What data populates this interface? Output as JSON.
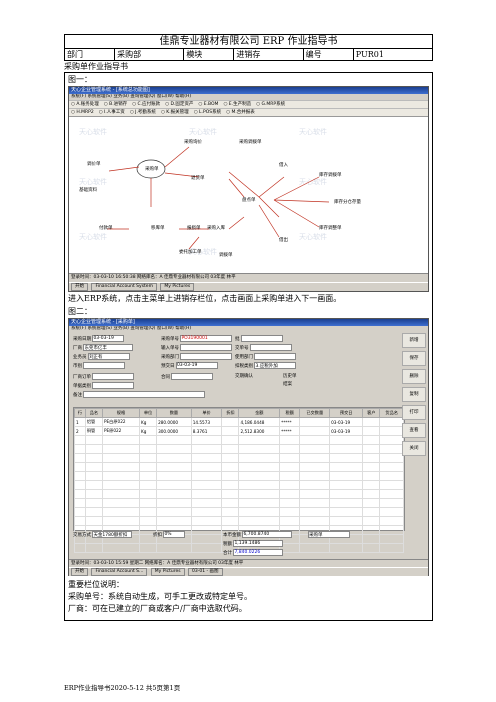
{
  "doc": {
    "title": "佳鼎专业器材有限公司 ERP 作业指导书",
    "subtitle": "采购单作业指导书",
    "figure1_label": "图一：",
    "figure2_label": "图二：",
    "caption1": "进入ERP系统，点击主菜单上进销存栏位，点击画面上采购单进入下一画面。"
  },
  "meta": {
    "dept_label": "部门",
    "dept_value": "采购部",
    "module_label": "模块",
    "module_value": "进销存",
    "number_label": "编号",
    "number_value": "PUR01"
  },
  "shot1": {
    "title": "天心企业管理系统 - [系统总功能图]",
    "menu": "系统(F) 系统管理(S) 业务(B) 查询管理(Q) 窗口(W) 帮助(H)",
    "modules": [
      "A.账务处理",
      "B.进销存",
      "C.应付账款",
      "D.固定资产",
      "E.BOM",
      "E.生产制造",
      "G.MRP系统"
    ],
    "modules2": [
      "H.MRP2",
      "I.人事工资",
      "J.考勤系统",
      "K.报关管理",
      "L.POS系统",
      "M.合并报表"
    ],
    "nodes": [
      "采购单",
      "采购询价",
      "采购调拨单",
      "调价单",
      "退货单",
      "基础资料",
      "借入",
      "库存调拨单",
      "付款单",
      "移库单",
      "盘点单",
      "库存分仓存量",
      "报损单",
      "借出",
      "库存调整单",
      "委托加工单",
      "调拨单",
      "采购入库"
    ],
    "watermark": "天心软件",
    "status": "登录时间：03-03-10 16:50:38 网络库名：A 佳鼎专业器材有限公司 03年度 林平",
    "task": [
      "开始",
      "Financial Account System",
      "My Pictures"
    ]
  },
  "shot2": {
    "title": "天心企业管理系统 - [采购单]",
    "fields": {
      "date_label": "采购日期",
      "date_value": "03-03-19",
      "order_label": "采购单号",
      "order_value": "PO3190001",
      "vendor_label": "厂商",
      "vendor_value": "东莞市亿丰",
      "enter_label": "输入单号",
      "buyer_label": "业务员",
      "buyer_value": "刘正有",
      "dept_label": "采购部门",
      "place_label": "币别",
      "deliver_label": "预交日",
      "deliver_value": "03-03-19",
      "tax_label": "扣税类别",
      "tax_value": "3.应税外加",
      "bag_label": "批",
      "ship_label": "交单号",
      "use_label": "使用部门",
      "vendor_order_label": "厂商订单",
      "contract_label": "合同",
      "dept_code_label": "单据类别",
      "remark_label": "备注",
      "chk1": "交期确认",
      "chk2": "历史单",
      "chk3": "结案"
    },
    "columns": [
      "行",
      "品名",
      "规格",
      "单位",
      "数量",
      "单价",
      "折扣",
      "金额",
      "税额",
      "已交数量",
      "预交日",
      "客户",
      "货品名"
    ],
    "rows": [
      [
        "1",
        "铝管",
        "PE白原022",
        "Kg",
        "280.0000",
        "14.5573",
        "",
        "4,186.0448",
        "*****",
        "",
        "03-03-19",
        "",
        ""
      ],
      [
        "2",
        "铜管",
        "PE原022",
        "Kg",
        "300.0000",
        "8.3761",
        "",
        "2,512.8300",
        "*****",
        "",
        "03-03-19",
        "",
        ""
      ]
    ],
    "footer": {
      "pay_label": "交易方式",
      "pay_value": "天金1780额折扣",
      "disc_label": "折扣",
      "disc_value": "0%",
      "amount_label": "本币金额",
      "amount_value": "6,700.8740",
      "tax_label": "税额",
      "tax_value": "1,139.1486",
      "total_label": "合计",
      "total_value": "7,840.0226",
      "sel_value": "采购单"
    },
    "tools": [
      "新增",
      "保存",
      "删除",
      "复制",
      "打印",
      "查看",
      "关闭"
    ],
    "status": "登录时间：03-03-10 15:59 星期二 网络库名：A 佳鼎专业器材有限公司 03年度 林平",
    "task": [
      "开始",
      "Financial Account S...",
      "My Pictures",
      "03-01 - 画图"
    ]
  },
  "notes": {
    "heading": "重要栏位说明：",
    "line1": "采购单号：系统自动生成，可手工更改或特定单号。",
    "line2": "厂商：可在已建立的厂商或客户/厂商中选取代码。"
  },
  "footer": "ERP作业指导书2020-5-12 共5页第1页"
}
